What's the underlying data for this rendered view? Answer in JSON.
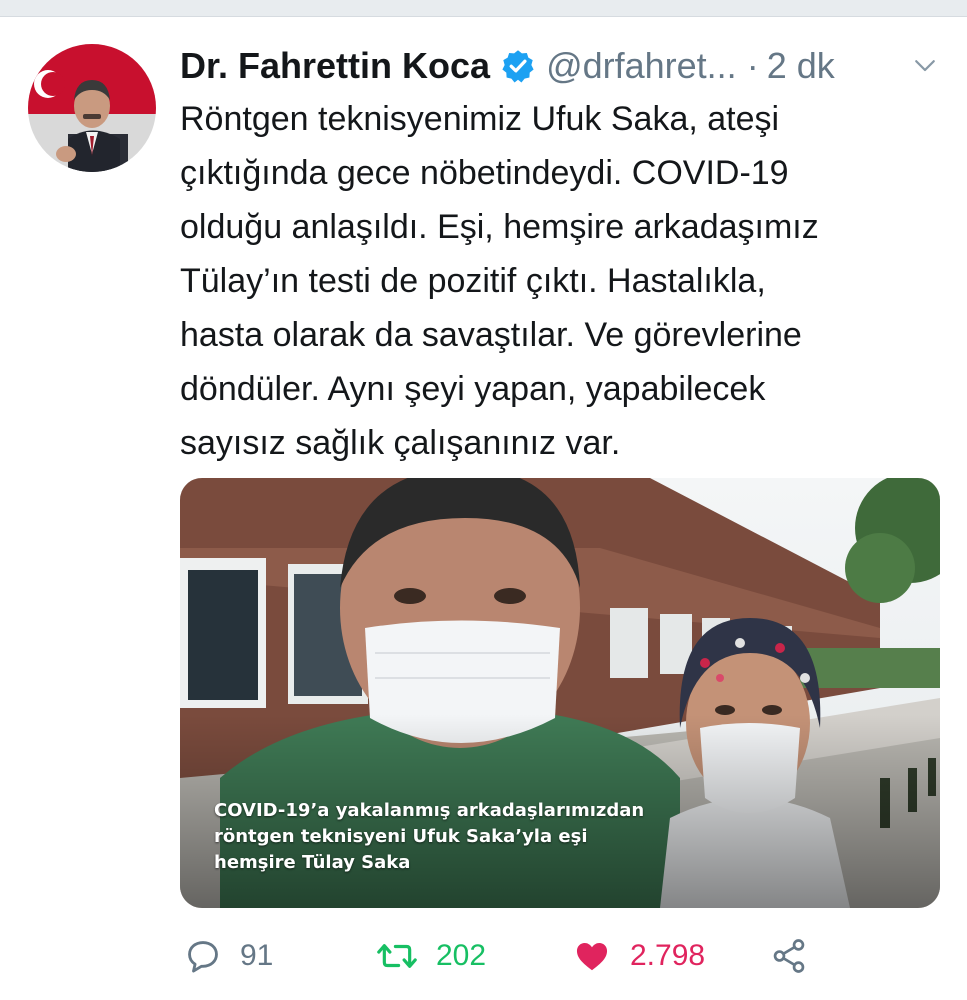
{
  "tweet": {
    "author_name": "Dr. Fahrettin Koca",
    "handle": "@drfahret...",
    "separator": "·",
    "time": "2 dk",
    "text_lines": [
      "Röntgen teknisyenimiz Ufuk Saka, ateşi",
      "çıktığında gece nöbetindeydi. COVID-19",
      "olduğu anlaşıldı. Eşi, hemşire arkadaşımız",
      "Tülay’ın testi de pozitif çıktı. Hastalıkla,",
      "hasta olarak da savaştılar. Ve görevlerine",
      "döndüler. Aynı şeyi yapan, yapabilecek",
      "sayısız sağlık çalışanınız var."
    ],
    "media_caption_lines": [
      "COVID-19’a yakalanmış arkadaşlarımızdan",
      "röntgen teknisyeni Ufuk Saka’yla eşi",
      "hemşire Tülay Saka"
    ],
    "stats": {
      "replies": "91",
      "retweets": "202",
      "likes": "2.798"
    }
  },
  "icons": {
    "verified": "verified-badge-icon",
    "menu": "chevron-down-icon",
    "reply": "speech-bubble-icon",
    "retweet": "retweet-arrows-icon",
    "like": "heart-icon",
    "share": "share-icon"
  },
  "colors": {
    "text": "#14171a",
    "secondary": "#657786",
    "verified": "#1da1f2",
    "retweet": "#17bf63",
    "like": "#e0245e"
  }
}
